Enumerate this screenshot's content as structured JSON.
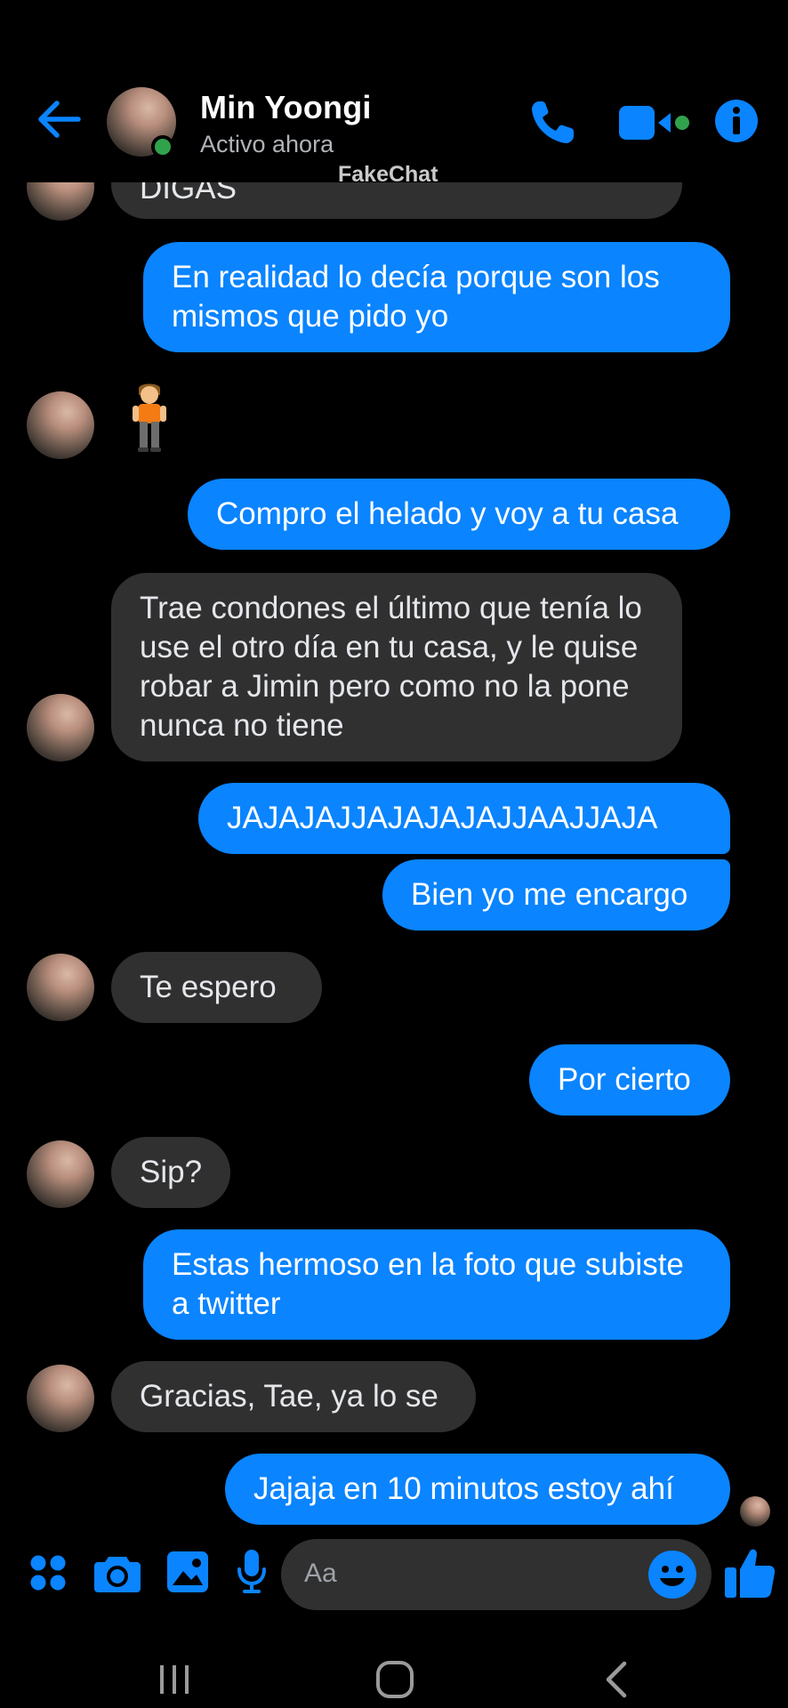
{
  "header": {
    "contact_name": "Min Yoongi",
    "status": "Activo ahora",
    "watermark": "FakeChat"
  },
  "messages": [
    {
      "side": "in",
      "text": "DIGAS"
    },
    {
      "side": "out",
      "text": "En realidad lo decía porque son los mismos que pido yo"
    },
    {
      "side": "in",
      "text": "",
      "emoji": "person-standing-emoji"
    },
    {
      "side": "out",
      "text": "Compro el helado y voy a tu casa"
    },
    {
      "side": "in",
      "text": "Trae condones el último que tenía lo use el otro día en tu casa, y le quise robar a Jimin pero como no la pone nunca no tiene"
    },
    {
      "side": "out",
      "text": "JAJAJAJJAJAJAJAJJAAJJAJA"
    },
    {
      "side": "out",
      "text": "Bien yo me encargo"
    },
    {
      "side": "in",
      "text": "Te espero"
    },
    {
      "side": "out",
      "text": "Por cierto"
    },
    {
      "side": "in",
      "text": "Sip?"
    },
    {
      "side": "out",
      "text": "Estas hermoso en la foto que subiste a twitter"
    },
    {
      "side": "in",
      "text": "Gracias, Tae, ya lo se"
    },
    {
      "side": "out",
      "text": "Jajaja en 10 minutos estoy ahí"
    }
  ],
  "composer": {
    "placeholder": "Aa"
  },
  "colors": {
    "accent": "#0a84ff",
    "incoming_bubble": "#303030",
    "background": "#000000",
    "online": "#31a24c"
  }
}
